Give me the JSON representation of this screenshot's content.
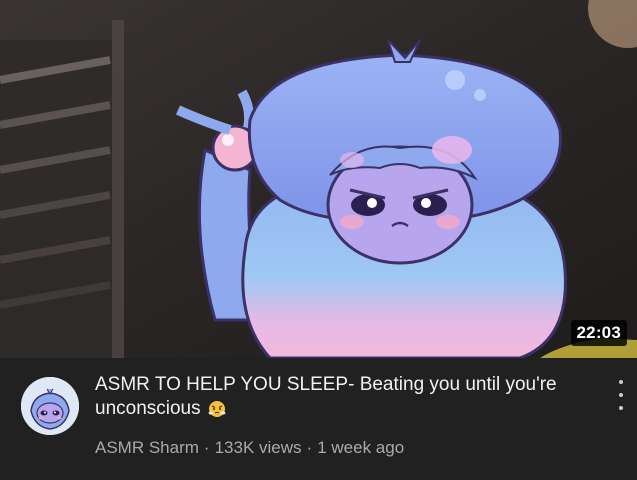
{
  "video": {
    "duration": "22:03",
    "title": "ASMR TO HELP YOU SLEEP- Beating you until you're unconscious",
    "title_emoji_icon": "steaming-angry-face-emoji",
    "channel": "ASMR Sharm",
    "views": "133K views",
    "age": "1 week ago",
    "separator": "·",
    "menu_icon": "more-vert-icon"
  },
  "colors": {
    "background": "#212121",
    "title_text": "#f1f1f1",
    "meta_text": "#aaaaaa",
    "character_blue": "#8fa9ef",
    "character_pink": "#f2b7dc"
  }
}
